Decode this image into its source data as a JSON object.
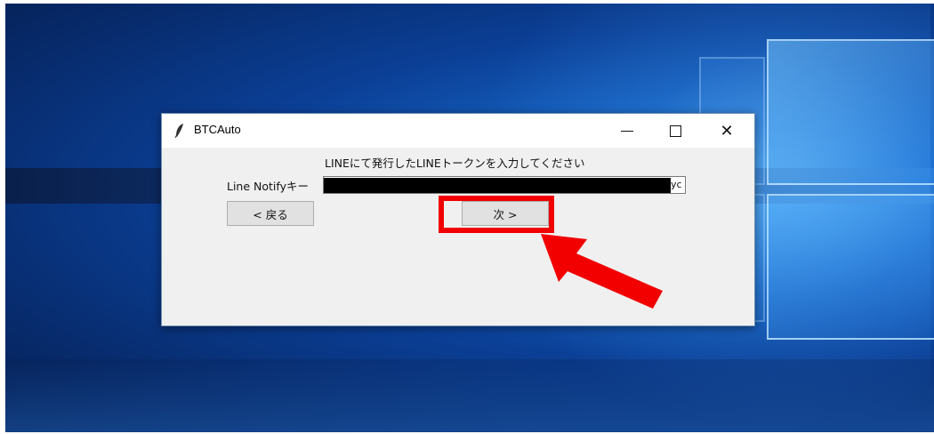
{
  "window": {
    "title": "BTCAuto",
    "icon": "feather-icon"
  },
  "dialog": {
    "instruction": "LINEにて発行したLINEトークンを入力してください",
    "key_label": "Line Notifyキー",
    "key_value_visible_suffix": "yc",
    "back_label": "< 戻る",
    "next_label": "次 >"
  },
  "annotation": {
    "highlight_color": "#f20000",
    "arrow_color": "#f20000"
  }
}
